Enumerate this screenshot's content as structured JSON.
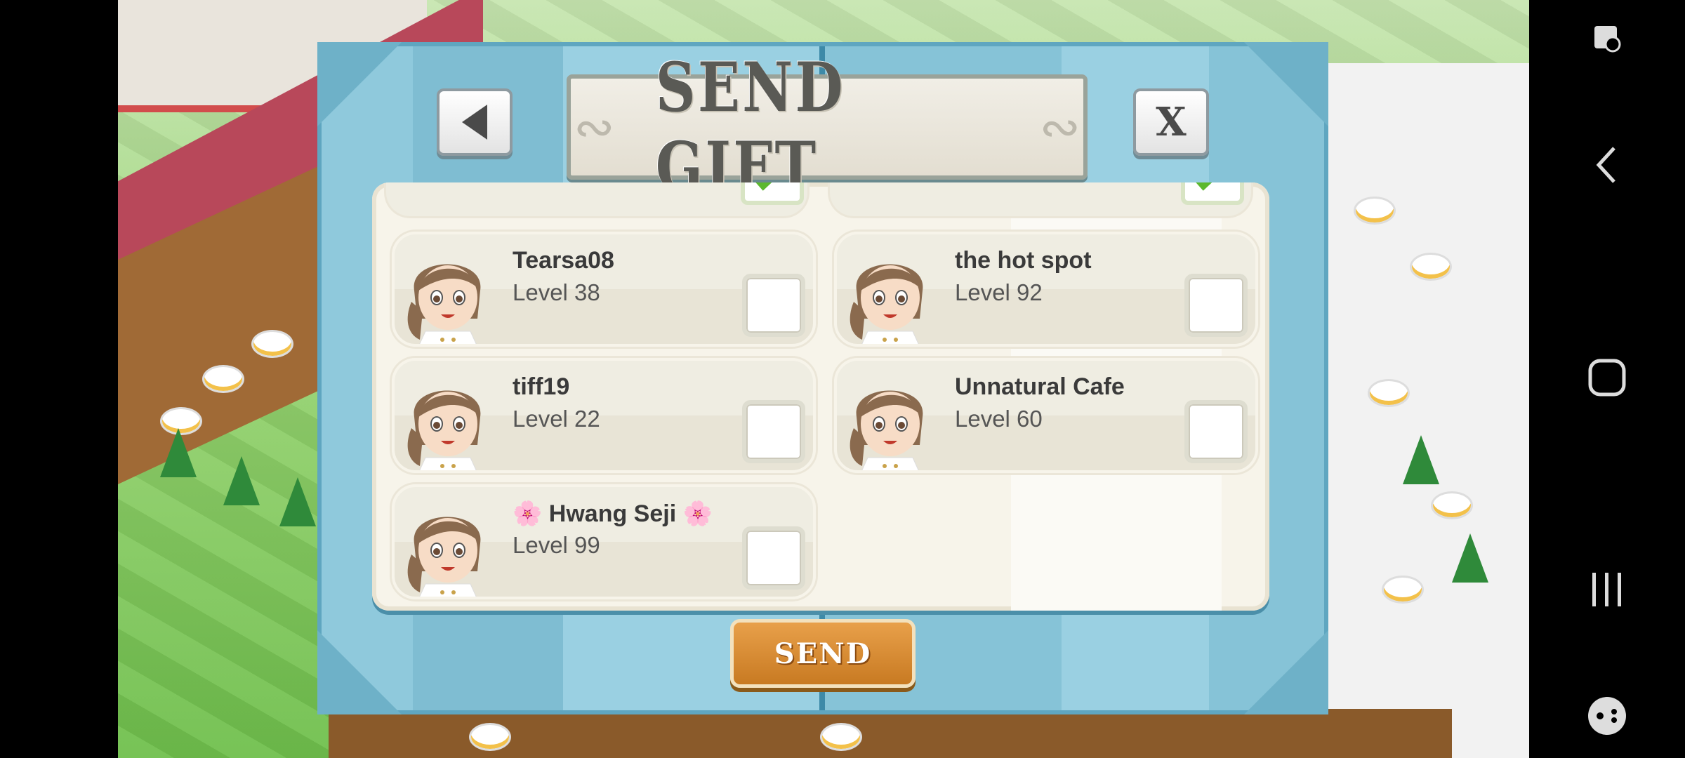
{
  "dialog": {
    "title": "SEND GIFT",
    "back_icon": "back-arrow-icon",
    "close_label": "X",
    "send_label": "SEND"
  },
  "friends": [
    {
      "name": "Tearsa08",
      "level": "Level 38",
      "checked": false
    },
    {
      "name": "the hot spot",
      "level": "Level 92",
      "checked": false
    },
    {
      "name": "tiff19",
      "level": "Level 22",
      "checked": false
    },
    {
      "name": "Unnatural Cafe",
      "level": "Level 60",
      "checked": false
    },
    {
      "name": "🌸 Hwang Seji 🌸",
      "level": "Level 99",
      "checked": false
    }
  ],
  "navbar": {
    "icons": [
      "screenshot-edit-icon",
      "back-icon",
      "home-icon",
      "recent-apps-icon",
      "game-tools-icon"
    ]
  },
  "colors": {
    "dialog_blue": "#8fc9dc",
    "panel_cream": "#f7f4ea",
    "send_orange": "#d98a30",
    "check_green": "#5cb82e"
  }
}
